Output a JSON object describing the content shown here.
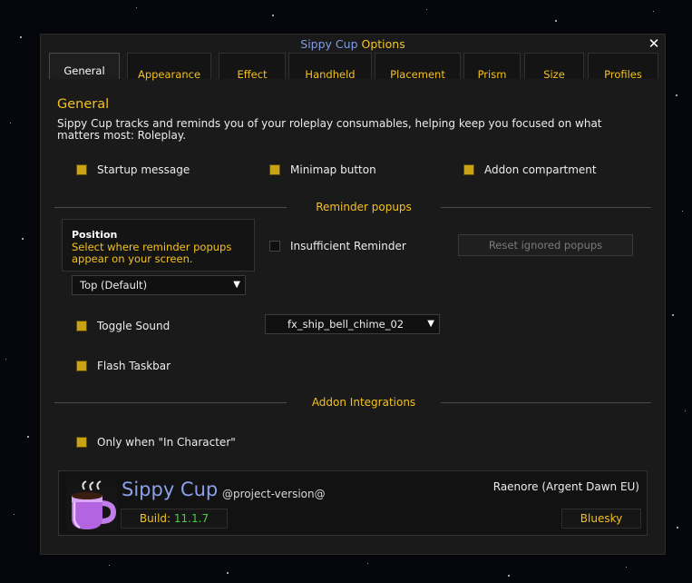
{
  "window": {
    "title_part1": "Sippy Cup",
    "title_part2": "Options"
  },
  "tabs": [
    {
      "label": "General",
      "active": true
    },
    {
      "label": "Appearance"
    },
    {
      "label": "Effect"
    },
    {
      "label": "Handheld"
    },
    {
      "label": "Placement"
    },
    {
      "label": "Prism"
    },
    {
      "label": "Size"
    },
    {
      "label": "Profiles"
    }
  ],
  "general": {
    "title": "General",
    "description": "Sippy Cup tracks and reminds you of your roleplay consumables, helping keep you focused on what matters most: Roleplay.",
    "startup_message": {
      "label": "Startup message",
      "checked": true
    },
    "minimap_button": {
      "label": "Minimap button",
      "checked": true
    },
    "addon_compartment": {
      "label": "Addon compartment",
      "checked": true
    }
  },
  "reminder": {
    "header": "Reminder popups",
    "position_title": "Position",
    "position_desc": "Select where reminder popups appear on your screen.",
    "position_value": "Top (Default)",
    "insufficient": {
      "label": "Insufficient Reminder",
      "checked": false
    },
    "reset_button": "Reset ignored popups",
    "toggle_sound": {
      "label": "Toggle Sound",
      "checked": true
    },
    "sound_value": "fx_ship_bell_chime_02",
    "flash_taskbar": {
      "label": "Flash Taskbar",
      "checked": true
    }
  },
  "integrations": {
    "header": "Addon Integrations",
    "in_character": {
      "label": "Only when \"In Character\"",
      "checked": true
    }
  },
  "footer": {
    "brand": "Sippy Cup",
    "version": "@project-version@",
    "build_label": "Build:",
    "build_value": "11.1.7",
    "author": "Raenore (Argent Dawn EU)",
    "bluesky": "Bluesky"
  },
  "colors": {
    "accent": "#f4c21c",
    "brand": "#8ba0e6",
    "build": "#3ed43e",
    "checkbox": "#c9a317"
  }
}
